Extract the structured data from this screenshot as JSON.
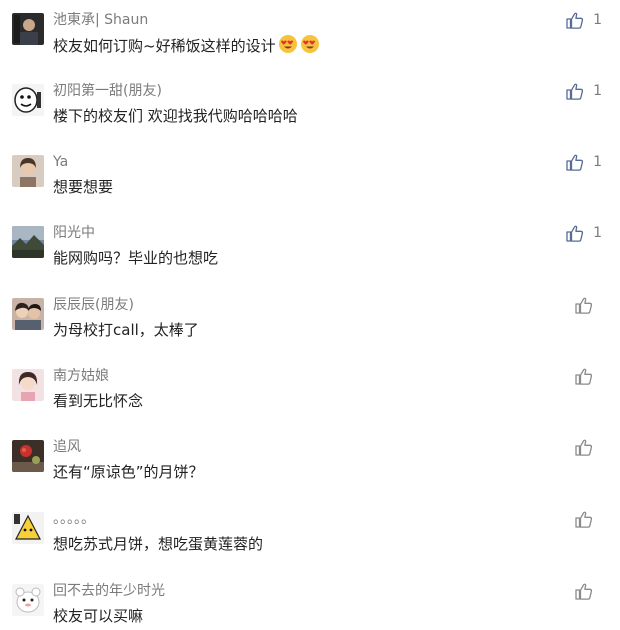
{
  "comments": [
    {
      "name": "池東承| Shaun",
      "text": "校友如何订购~好稀饭这样的设计",
      "emoji_count": 2,
      "emoji": "heart-eyes-emoji",
      "likes": "1",
      "avatar": "dark-photo"
    },
    {
      "name": "初阳第一甜(朋友)",
      "text": "楼下的校友们 欢迎找我代购哈哈哈哈",
      "likes": "1",
      "avatar": "cartoon-face"
    },
    {
      "name": "Ya",
      "text": "想要想要",
      "likes": "1",
      "avatar": "portrait"
    },
    {
      "name": "阳光中",
      "text": "能网购吗？毕业的也想吃",
      "likes": "1",
      "avatar": "landscape"
    },
    {
      "name": "辰辰辰(朋友)",
      "text": "为母校打call，太棒了",
      "likes": "",
      "avatar": "couple-photo"
    },
    {
      "name": "南方姑娘",
      "text": "看到无比怀念",
      "likes": "",
      "avatar": "girl-photo"
    },
    {
      "name": "追风",
      "text": "还有“原谅色”的月饼？",
      "likes": "",
      "avatar": "dark-flower"
    },
    {
      "name": "。。。。。",
      "text": "想吃苏式月饼，想吃蛋黄莲蓉的",
      "likes": "",
      "avatar": "cartoon-yellow"
    },
    {
      "name": "回不去的年少时光",
      "text": "校友可以买嘛",
      "likes": "",
      "avatar": "cartoon-white"
    }
  ],
  "colors": {
    "name": "#7b7b7b",
    "text": "#222222",
    "like_icon": "#576b95",
    "like_icon_inactive": "#8a8a8a"
  }
}
